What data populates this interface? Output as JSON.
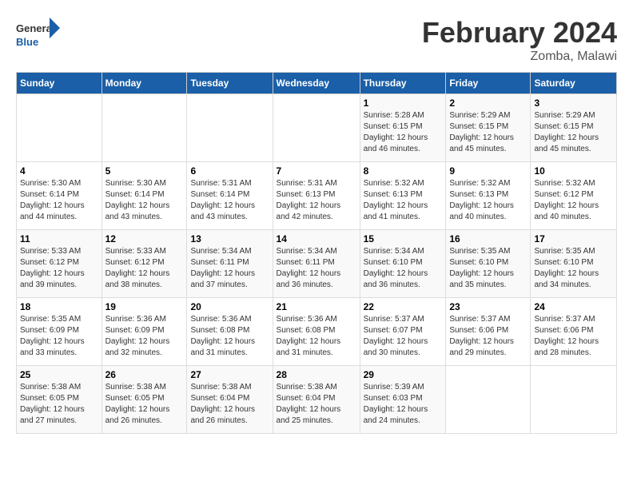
{
  "header": {
    "logo_general": "General",
    "logo_blue": "Blue",
    "month_title": "February 2024",
    "subtitle": "Zomba, Malawi"
  },
  "days_of_week": [
    "Sunday",
    "Monday",
    "Tuesday",
    "Wednesday",
    "Thursday",
    "Friday",
    "Saturday"
  ],
  "weeks": [
    [
      {
        "day": "",
        "info": ""
      },
      {
        "day": "",
        "info": ""
      },
      {
        "day": "",
        "info": ""
      },
      {
        "day": "",
        "info": ""
      },
      {
        "day": "1",
        "info": "Sunrise: 5:28 AM\nSunset: 6:15 PM\nDaylight: 12 hours\nand 46 minutes."
      },
      {
        "day": "2",
        "info": "Sunrise: 5:29 AM\nSunset: 6:15 PM\nDaylight: 12 hours\nand 45 minutes."
      },
      {
        "day": "3",
        "info": "Sunrise: 5:29 AM\nSunset: 6:15 PM\nDaylight: 12 hours\nand 45 minutes."
      }
    ],
    [
      {
        "day": "4",
        "info": "Sunrise: 5:30 AM\nSunset: 6:14 PM\nDaylight: 12 hours\nand 44 minutes."
      },
      {
        "day": "5",
        "info": "Sunrise: 5:30 AM\nSunset: 6:14 PM\nDaylight: 12 hours\nand 43 minutes."
      },
      {
        "day": "6",
        "info": "Sunrise: 5:31 AM\nSunset: 6:14 PM\nDaylight: 12 hours\nand 43 minutes."
      },
      {
        "day": "7",
        "info": "Sunrise: 5:31 AM\nSunset: 6:13 PM\nDaylight: 12 hours\nand 42 minutes."
      },
      {
        "day": "8",
        "info": "Sunrise: 5:32 AM\nSunset: 6:13 PM\nDaylight: 12 hours\nand 41 minutes."
      },
      {
        "day": "9",
        "info": "Sunrise: 5:32 AM\nSunset: 6:13 PM\nDaylight: 12 hours\nand 40 minutes."
      },
      {
        "day": "10",
        "info": "Sunrise: 5:32 AM\nSunset: 6:12 PM\nDaylight: 12 hours\nand 40 minutes."
      }
    ],
    [
      {
        "day": "11",
        "info": "Sunrise: 5:33 AM\nSunset: 6:12 PM\nDaylight: 12 hours\nand 39 minutes."
      },
      {
        "day": "12",
        "info": "Sunrise: 5:33 AM\nSunset: 6:12 PM\nDaylight: 12 hours\nand 38 minutes."
      },
      {
        "day": "13",
        "info": "Sunrise: 5:34 AM\nSunset: 6:11 PM\nDaylight: 12 hours\nand 37 minutes."
      },
      {
        "day": "14",
        "info": "Sunrise: 5:34 AM\nSunset: 6:11 PM\nDaylight: 12 hours\nand 36 minutes."
      },
      {
        "day": "15",
        "info": "Sunrise: 5:34 AM\nSunset: 6:10 PM\nDaylight: 12 hours\nand 36 minutes."
      },
      {
        "day": "16",
        "info": "Sunrise: 5:35 AM\nSunset: 6:10 PM\nDaylight: 12 hours\nand 35 minutes."
      },
      {
        "day": "17",
        "info": "Sunrise: 5:35 AM\nSunset: 6:10 PM\nDaylight: 12 hours\nand 34 minutes."
      }
    ],
    [
      {
        "day": "18",
        "info": "Sunrise: 5:35 AM\nSunset: 6:09 PM\nDaylight: 12 hours\nand 33 minutes."
      },
      {
        "day": "19",
        "info": "Sunrise: 5:36 AM\nSunset: 6:09 PM\nDaylight: 12 hours\nand 32 minutes."
      },
      {
        "day": "20",
        "info": "Sunrise: 5:36 AM\nSunset: 6:08 PM\nDaylight: 12 hours\nand 31 minutes."
      },
      {
        "day": "21",
        "info": "Sunrise: 5:36 AM\nSunset: 6:08 PM\nDaylight: 12 hours\nand 31 minutes."
      },
      {
        "day": "22",
        "info": "Sunrise: 5:37 AM\nSunset: 6:07 PM\nDaylight: 12 hours\nand 30 minutes."
      },
      {
        "day": "23",
        "info": "Sunrise: 5:37 AM\nSunset: 6:06 PM\nDaylight: 12 hours\nand 29 minutes."
      },
      {
        "day": "24",
        "info": "Sunrise: 5:37 AM\nSunset: 6:06 PM\nDaylight: 12 hours\nand 28 minutes."
      }
    ],
    [
      {
        "day": "25",
        "info": "Sunrise: 5:38 AM\nSunset: 6:05 PM\nDaylight: 12 hours\nand 27 minutes."
      },
      {
        "day": "26",
        "info": "Sunrise: 5:38 AM\nSunset: 6:05 PM\nDaylight: 12 hours\nand 26 minutes."
      },
      {
        "day": "27",
        "info": "Sunrise: 5:38 AM\nSunset: 6:04 PM\nDaylight: 12 hours\nand 26 minutes."
      },
      {
        "day": "28",
        "info": "Sunrise: 5:38 AM\nSunset: 6:04 PM\nDaylight: 12 hours\nand 25 minutes."
      },
      {
        "day": "29",
        "info": "Sunrise: 5:39 AM\nSunset: 6:03 PM\nDaylight: 12 hours\nand 24 minutes."
      },
      {
        "day": "",
        "info": ""
      },
      {
        "day": "",
        "info": ""
      }
    ]
  ]
}
